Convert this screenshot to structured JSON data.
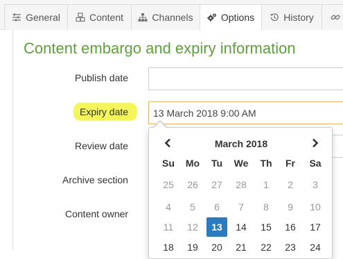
{
  "tabs": [
    {
      "label": "General",
      "icon": "sliders-icon"
    },
    {
      "label": "Content",
      "icon": "cubes-icon"
    },
    {
      "label": "Channels",
      "icon": "sitemap-icon"
    },
    {
      "label": "Options",
      "icon": "cogs-icon",
      "active": true
    },
    {
      "label": "History",
      "icon": "history-icon"
    }
  ],
  "heading": "Content embargo and expiry information",
  "fields": {
    "publish_date": {
      "label": "Publish date",
      "value": ""
    },
    "expiry_date": {
      "label": "Expiry date",
      "value": "13 March 2018 9:00 AM",
      "highlight": "#f4f55a"
    },
    "review_date": {
      "label": "Review date"
    },
    "archive_section": {
      "label": "Archive section"
    },
    "content_owner": {
      "label": "Content owner"
    }
  },
  "calendar": {
    "month_label": "March 2018",
    "weekdays": [
      "Su",
      "Mo",
      "Tu",
      "We",
      "Th",
      "Fr",
      "Sa"
    ],
    "weeks": [
      [
        {
          "d": "25",
          "m": true
        },
        {
          "d": "26",
          "m": true
        },
        {
          "d": "27",
          "m": true
        },
        {
          "d": "28",
          "m": true
        },
        {
          "d": "1",
          "m": true
        },
        {
          "d": "2",
          "m": true
        },
        {
          "d": "3",
          "m": true
        }
      ],
      [
        {
          "d": "4",
          "m": true
        },
        {
          "d": "5",
          "m": true
        },
        {
          "d": "6",
          "m": true
        },
        {
          "d": "7",
          "m": true
        },
        {
          "d": "8",
          "m": true
        },
        {
          "d": "9",
          "m": true
        },
        {
          "d": "10",
          "m": true
        }
      ],
      [
        {
          "d": "11",
          "m": true
        },
        {
          "d": "12",
          "m": true
        },
        {
          "d": "13",
          "s": true
        },
        {
          "d": "14"
        },
        {
          "d": "15"
        },
        {
          "d": "16"
        },
        {
          "d": "17"
        }
      ],
      [
        {
          "d": "18"
        },
        {
          "d": "19"
        },
        {
          "d": "20"
        },
        {
          "d": "21"
        },
        {
          "d": "22"
        },
        {
          "d": "23"
        },
        {
          "d": "24"
        }
      ]
    ]
  },
  "colors": {
    "accent": "#2d7bbf",
    "heading": "#5f9f3f",
    "focus_border": "#e8b56f"
  }
}
